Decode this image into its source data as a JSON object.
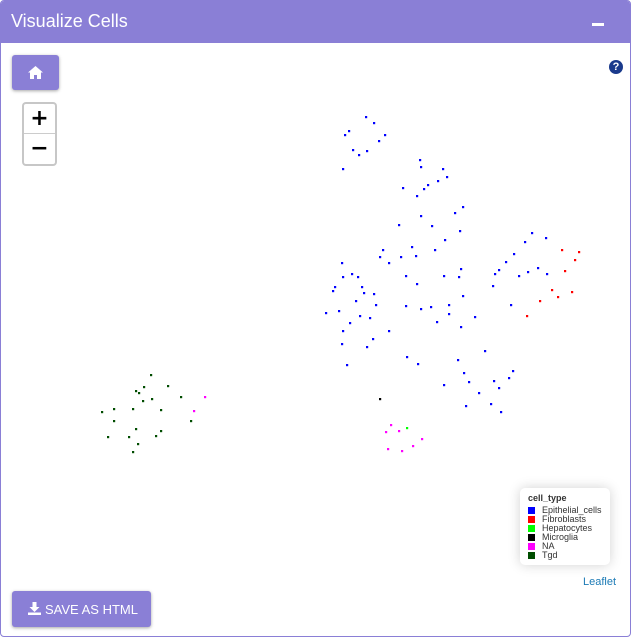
{
  "panel": {
    "title": "Visualize Cells",
    "collapse_icon": "minus-icon"
  },
  "controls": {
    "home_icon": "home-icon",
    "help_label": "?",
    "zoom_in": "+",
    "zoom_out": "−",
    "attribution": "Leaflet",
    "save_label": "SAVE AS HTML",
    "save_icon": "download-icon"
  },
  "legend": {
    "title": "cell_type",
    "items": [
      {
        "label": "Epithelial_cells",
        "color": "#0000ff"
      },
      {
        "label": "Fibroblasts",
        "color": "#ff0000"
      },
      {
        "label": "Hepatocytes",
        "color": "#00ff00"
      },
      {
        "label": "Microglia",
        "color": "#000000"
      },
      {
        "label": "NA",
        "color": "#ff00ff"
      },
      {
        "label": "Tgd",
        "color": "#004d00"
      }
    ]
  },
  "chart_data": {
    "type": "scatter",
    "series": [
      {
        "name": "Epithelial_cells",
        "color": "#0000ff",
        "points": [
          [
            365,
            116
          ],
          [
            373,
            122
          ],
          [
            348,
            130
          ],
          [
            344,
            134
          ],
          [
            384,
            134
          ],
          [
            378,
            140
          ],
          [
            352,
            149
          ],
          [
            366,
            150
          ],
          [
            358,
            154
          ],
          [
            342,
            168
          ],
          [
            419,
            159
          ],
          [
            420,
            166
          ],
          [
            442,
            168
          ],
          [
            446,
            176
          ],
          [
            437,
            180
          ],
          [
            427,
            184
          ],
          [
            423,
            188
          ],
          [
            402,
            187
          ],
          [
            416,
            195
          ],
          [
            462,
            206
          ],
          [
            454,
            212
          ],
          [
            420,
            215
          ],
          [
            398,
            224
          ],
          [
            459,
            230
          ],
          [
            431,
            225
          ],
          [
            444,
            239
          ],
          [
            434,
            249
          ],
          [
            411,
            246
          ],
          [
            382,
            249
          ],
          [
            379,
            256
          ],
          [
            388,
            262
          ],
          [
            400,
            256
          ],
          [
            341,
            262
          ],
          [
            351,
            273
          ],
          [
            342,
            276
          ],
          [
            357,
            276
          ],
          [
            334,
            286
          ],
          [
            332,
            290
          ],
          [
            361,
            286
          ],
          [
            363,
            292
          ],
          [
            373,
            293
          ],
          [
            375,
            304
          ],
          [
            355,
            300
          ],
          [
            325,
            312
          ],
          [
            338,
            310
          ],
          [
            359,
            315
          ],
          [
            369,
            317
          ],
          [
            349,
            322
          ],
          [
            342,
            330
          ],
          [
            388,
            330
          ],
          [
            372,
            338
          ],
          [
            341,
            343
          ],
          [
            366,
            346
          ],
          [
            346,
            364
          ],
          [
            415,
            255
          ],
          [
            405,
            275
          ],
          [
            416,
            283
          ],
          [
            443,
            275
          ],
          [
            458,
            276
          ],
          [
            460,
            268
          ],
          [
            462,
            295
          ],
          [
            448,
            304
          ],
          [
            420,
            308
          ],
          [
            430,
            306
          ],
          [
            405,
            305
          ],
          [
            448,
            313
          ],
          [
            436,
            321
          ],
          [
            460,
            326
          ],
          [
            474,
            316
          ],
          [
            484,
            350
          ],
          [
            406,
            356
          ],
          [
            417,
            363
          ],
          [
            457,
            359
          ],
          [
            463,
            372
          ],
          [
            468,
            381
          ],
          [
            493,
            380
          ],
          [
            443,
            384
          ],
          [
            478,
            392
          ],
          [
            508,
            377
          ],
          [
            512,
            370
          ],
          [
            498,
            387
          ],
          [
            490,
            403
          ],
          [
            465,
            405
          ],
          [
            500,
            411
          ],
          [
            531,
            232
          ],
          [
            545,
            237
          ],
          [
            524,
            241
          ],
          [
            513,
            253
          ],
          [
            505,
            261
          ],
          [
            494,
            273
          ],
          [
            498,
            269
          ],
          [
            518,
            275
          ],
          [
            527,
            271
          ],
          [
            537,
            267
          ],
          [
            546,
            273
          ],
          [
            492,
            285
          ],
          [
            510,
            304
          ]
        ]
      },
      {
        "name": "Fibroblasts",
        "color": "#ff0000",
        "points": [
          [
            561,
            249
          ],
          [
            578,
            251
          ],
          [
            574,
            259
          ],
          [
            564,
            270
          ],
          [
            551,
            289
          ],
          [
            557,
            296
          ],
          [
            571,
            291
          ],
          [
            539,
            300
          ],
          [
            526,
            315
          ]
        ]
      },
      {
        "name": "Hepatocytes",
        "color": "#00ff00",
        "points": [
          [
            406,
            427
          ]
        ]
      },
      {
        "name": "Microglia",
        "color": "#000000",
        "points": [
          [
            379,
            398
          ]
        ]
      },
      {
        "name": "NA",
        "color": "#ff00ff",
        "points": [
          [
            204,
            396
          ],
          [
            193,
            410
          ],
          [
            390,
            424
          ],
          [
            385,
            431
          ],
          [
            398,
            430
          ],
          [
            421,
            438
          ],
          [
            412,
            445
          ],
          [
            401,
            450
          ],
          [
            387,
            448
          ]
        ]
      },
      {
        "name": "Tgd",
        "color": "#004d00",
        "points": [
          [
            150,
            374
          ],
          [
            143,
            386
          ],
          [
            167,
            385
          ],
          [
            135,
            390
          ],
          [
            138,
            392
          ],
          [
            180,
            396
          ],
          [
            151,
            398
          ],
          [
            142,
            400
          ],
          [
            132,
            408
          ],
          [
            160,
            409
          ],
          [
            113,
            408
          ],
          [
            101,
            411
          ],
          [
            113,
            420
          ],
          [
            190,
            420
          ],
          [
            135,
            428
          ],
          [
            160,
            430
          ],
          [
            107,
            436
          ],
          [
            128,
            436
          ],
          [
            155,
            435
          ],
          [
            137,
            443
          ],
          [
            132,
            451
          ]
        ]
      }
    ]
  }
}
